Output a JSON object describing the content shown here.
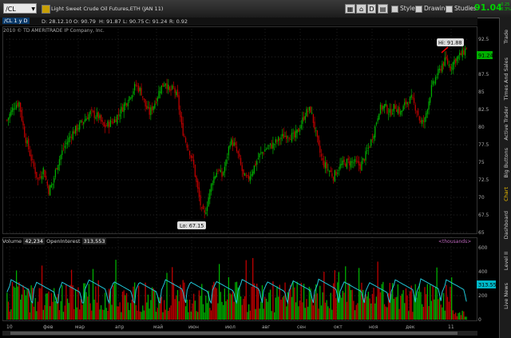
{
  "toolbar": {
    "symbol": "/CL",
    "description": "Light Sweet Crude Oil Futures,ETH (JAN 11)",
    "last_price": "91.04",
    "change_line1": "+0.25",
    "change_line2": "+0.3%",
    "d_label": "D",
    "style_label": "Style",
    "drawings_label": "Drawings",
    "studies_label": "Studies"
  },
  "info_bar": {
    "chart_badge": "/CL 1 y D",
    "date": "D: 28.12.10",
    "open": "O: 90.79",
    "high": "H: 91.87",
    "low": "L: 90.75",
    "close": "C: 91.24",
    "range": "R: 0.92"
  },
  "copyright": "2010 © TD AMERITRADE IP Company, Inc.",
  "volume_header": {
    "volume_label": "Volume",
    "volume_value": "42,234",
    "oi_label": "OpenInterest",
    "oi_value": "313,553",
    "units": "<thousands>"
  },
  "sidebar_tabs": [
    {
      "label": "Trade",
      "active": false
    },
    {
      "label": "Times And Sales",
      "active": false
    },
    {
      "label": "Active Trader",
      "active": false
    },
    {
      "label": "Big Buttons",
      "active": false
    },
    {
      "label": "Chart",
      "active": true
    },
    {
      "label": "Dashboard",
      "active": false
    },
    {
      "label": "Level II",
      "active": false
    },
    {
      "label": "Live News",
      "active": false
    }
  ],
  "colors": {
    "up": "#00b000",
    "down": "#c00000",
    "oi_line": "#20c8d8",
    "price_label_bg": "#00b000",
    "oi_label_bg": "#00b8c8"
  },
  "chart_data": {
    "type": "candlestick",
    "x_tick_labels": [
      "10",
      "фев",
      "мар",
      "апр",
      "май",
      "июн",
      "июл",
      "авг",
      "сен",
      "окт",
      "ноя",
      "дек",
      "11"
    ],
    "price_axis": {
      "ticks": [
        "92.5",
        "90",
        "87.5",
        "85",
        "82.5",
        "80",
        "77.5",
        "75",
        "72.5",
        "70",
        "67.5",
        "65"
      ],
      "ylim": [
        65,
        94
      ]
    },
    "volume_axis": {
      "ticks": [
        "600",
        "400",
        "200",
        "0"
      ],
      "ylim": [
        0,
        600
      ]
    },
    "annotations": {
      "high_label": "Hi: 91.88",
      "low_label": "Lo: 67.15",
      "last_price_label": "91.24",
      "oi_last_label": "313.55"
    },
    "price_path": [
      [
        0,
        81
      ],
      [
        5,
        83
      ],
      [
        9,
        83.5
      ],
      [
        13,
        79
      ],
      [
        18,
        75.5
      ],
      [
        23,
        72.5
      ],
      [
        27,
        74
      ],
      [
        31,
        71
      ],
      [
        34,
        72
      ],
      [
        37,
        74.5
      ],
      [
        42,
        77
      ],
      [
        48,
        79
      ],
      [
        55,
        80.5
      ],
      [
        62,
        82
      ],
      [
        68,
        81.5
      ],
      [
        72,
        80
      ],
      [
        76,
        80.5
      ],
      [
        80,
        81
      ],
      [
        85,
        82.5
      ],
      [
        90,
        84
      ],
      [
        96,
        86
      ],
      [
        100,
        85
      ],
      [
        103,
        83
      ],
      [
        106,
        82
      ],
      [
        110,
        83.5
      ],
      [
        114,
        85.5
      ],
      [
        118,
        86.5
      ],
      [
        121,
        85
      ],
      [
        124,
        85.5
      ],
      [
        127,
        84
      ],
      [
        130,
        80
      ],
      [
        133,
        78
      ],
      [
        136,
        76.5
      ],
      [
        139,
        74.5
      ],
      [
        141,
        72
      ],
      [
        143,
        70
      ],
      [
        145,
        68
      ],
      [
        147,
        67.5
      ],
      [
        150,
        70
      ],
      [
        153,
        72.5
      ],
      [
        157,
        74
      ],
      [
        160,
        73
      ],
      [
        163,
        75
      ],
      [
        166,
        78
      ],
      [
        169,
        77.5
      ],
      [
        172,
        76
      ],
      [
        176,
        73
      ],
      [
        179,
        72.5
      ],
      [
        183,
        74
      ],
      [
        188,
        76
      ],
      [
        193,
        77
      ],
      [
        198,
        77.5
      ],
      [
        204,
        78.5
      ],
      [
        209,
        79
      ],
      [
        214,
        78.5
      ],
      [
        218,
        80
      ],
      [
        222,
        82
      ],
      [
        226,
        82.5
      ],
      [
        229,
        80
      ],
      [
        232,
        77
      ],
      [
        235,
        75
      ],
      [
        239,
        74
      ],
      [
        243,
        73
      ],
      [
        248,
        74.5
      ],
      [
        253,
        75
      ],
      [
        258,
        75
      ],
      [
        263,
        74.5
      ],
      [
        267,
        76
      ],
      [
        271,
        78
      ],
      [
        274,
        80
      ],
      [
        277,
        82.5
      ],
      [
        281,
        83
      ],
      [
        285,
        82
      ],
      [
        289,
        83
      ],
      [
        293,
        82
      ],
      [
        297,
        83.5
      ],
      [
        301,
        84
      ],
      [
        305,
        82.5
      ],
      [
        308,
        80.5
      ],
      [
        311,
        81
      ],
      [
        313,
        83
      ],
      [
        316,
        85.5
      ],
      [
        319,
        87
      ],
      [
        322,
        88
      ],
      [
        324,
        89
      ],
      [
        327,
        89.5
      ],
      [
        330,
        88.5
      ],
      [
        333,
        89.5
      ],
      [
        336,
        90
      ],
      [
        339,
        90.5
      ],
      [
        342,
        91.3
      ]
    ],
    "oi_cycle_peaks": [
      52,
      30,
      30,
      55,
      38,
      32,
      56,
      34,
      40,
      57,
      36,
      45,
      58,
      35,
      28,
      52,
      60,
      52
    ]
  }
}
